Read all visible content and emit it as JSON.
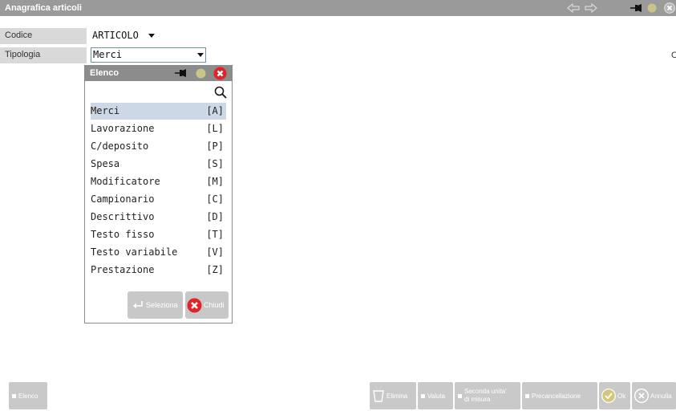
{
  "window": {
    "title": "Anagrafica articoli"
  },
  "fields": {
    "codice": {
      "label": "Codice",
      "value": "ARTICOLO"
    },
    "tipologia": {
      "label": "Tipologia",
      "value": "Merci"
    },
    "right_edge_text": "C"
  },
  "popup": {
    "title": "Elenco",
    "options": [
      {
        "label": "Merci",
        "key": "[A]"
      },
      {
        "label": "Lavorazione",
        "key": "[L]"
      },
      {
        "label": "C/deposito",
        "key": "[P]"
      },
      {
        "label": "Spesa",
        "key": "[S]"
      },
      {
        "label": "Modificatore",
        "key": "[M]"
      },
      {
        "label": "Campionario",
        "key": "[C]"
      },
      {
        "label": "Descrittivo",
        "key": "[D]"
      },
      {
        "label": "Testo fisso",
        "key": "[T]"
      },
      {
        "label": "Testo variabile",
        "key": "[V]"
      },
      {
        "label": "Prestazione",
        "key": "[Z]"
      }
    ],
    "selected_index": 0,
    "select_label": "Seleziona",
    "close_label": "Chiudi"
  },
  "bottombar": {
    "elenco": "Elenco",
    "elimina": "Elimina",
    "valuta": "Valuta",
    "seconda_line1": "Seconda unita'",
    "seconda_line2": "di misura",
    "precancellazione": "Precancellazione",
    "ok": "Ok",
    "annulla": "Annulla"
  },
  "colors": {
    "titlebar": "#9a9a9a",
    "selected_row": "#cdd8e6",
    "close_red": "#e0252a",
    "button_grey": "#c9c9c9"
  }
}
